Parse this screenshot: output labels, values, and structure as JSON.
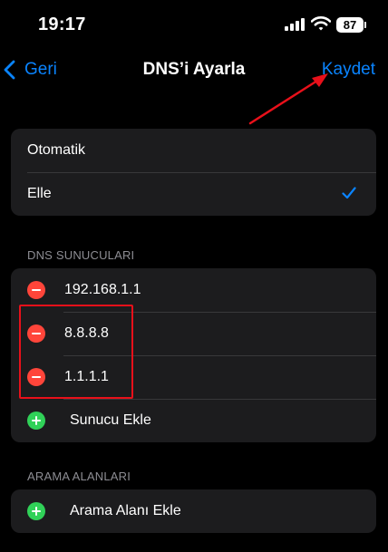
{
  "status_bar": {
    "time": "19:17",
    "battery": "87",
    "icons": [
      "signal-icon",
      "wifi-icon",
      "battery-icon"
    ]
  },
  "nav": {
    "back_label": "Geri",
    "title": "DNS’i Ayarla",
    "save_label": "Kaydet"
  },
  "mode": {
    "options": [
      "Otomatik",
      "Elle"
    ],
    "selected": "Elle"
  },
  "dns_servers": {
    "header": "DNS SUNUCULARI",
    "servers": [
      "192.168.1.1",
      "8.8.8.8",
      "1.1.1.1"
    ],
    "add_label": "Sunucu Ekle"
  },
  "search_domains": {
    "header": "ARAMA ALANLARI",
    "add_label": "Arama Alanı Ekle"
  },
  "colors": {
    "accent": "#0a84ff",
    "remove": "#ff453a",
    "add": "#30d158",
    "annotation": "#e8101a",
    "cell_background": "#1c1c1e"
  }
}
